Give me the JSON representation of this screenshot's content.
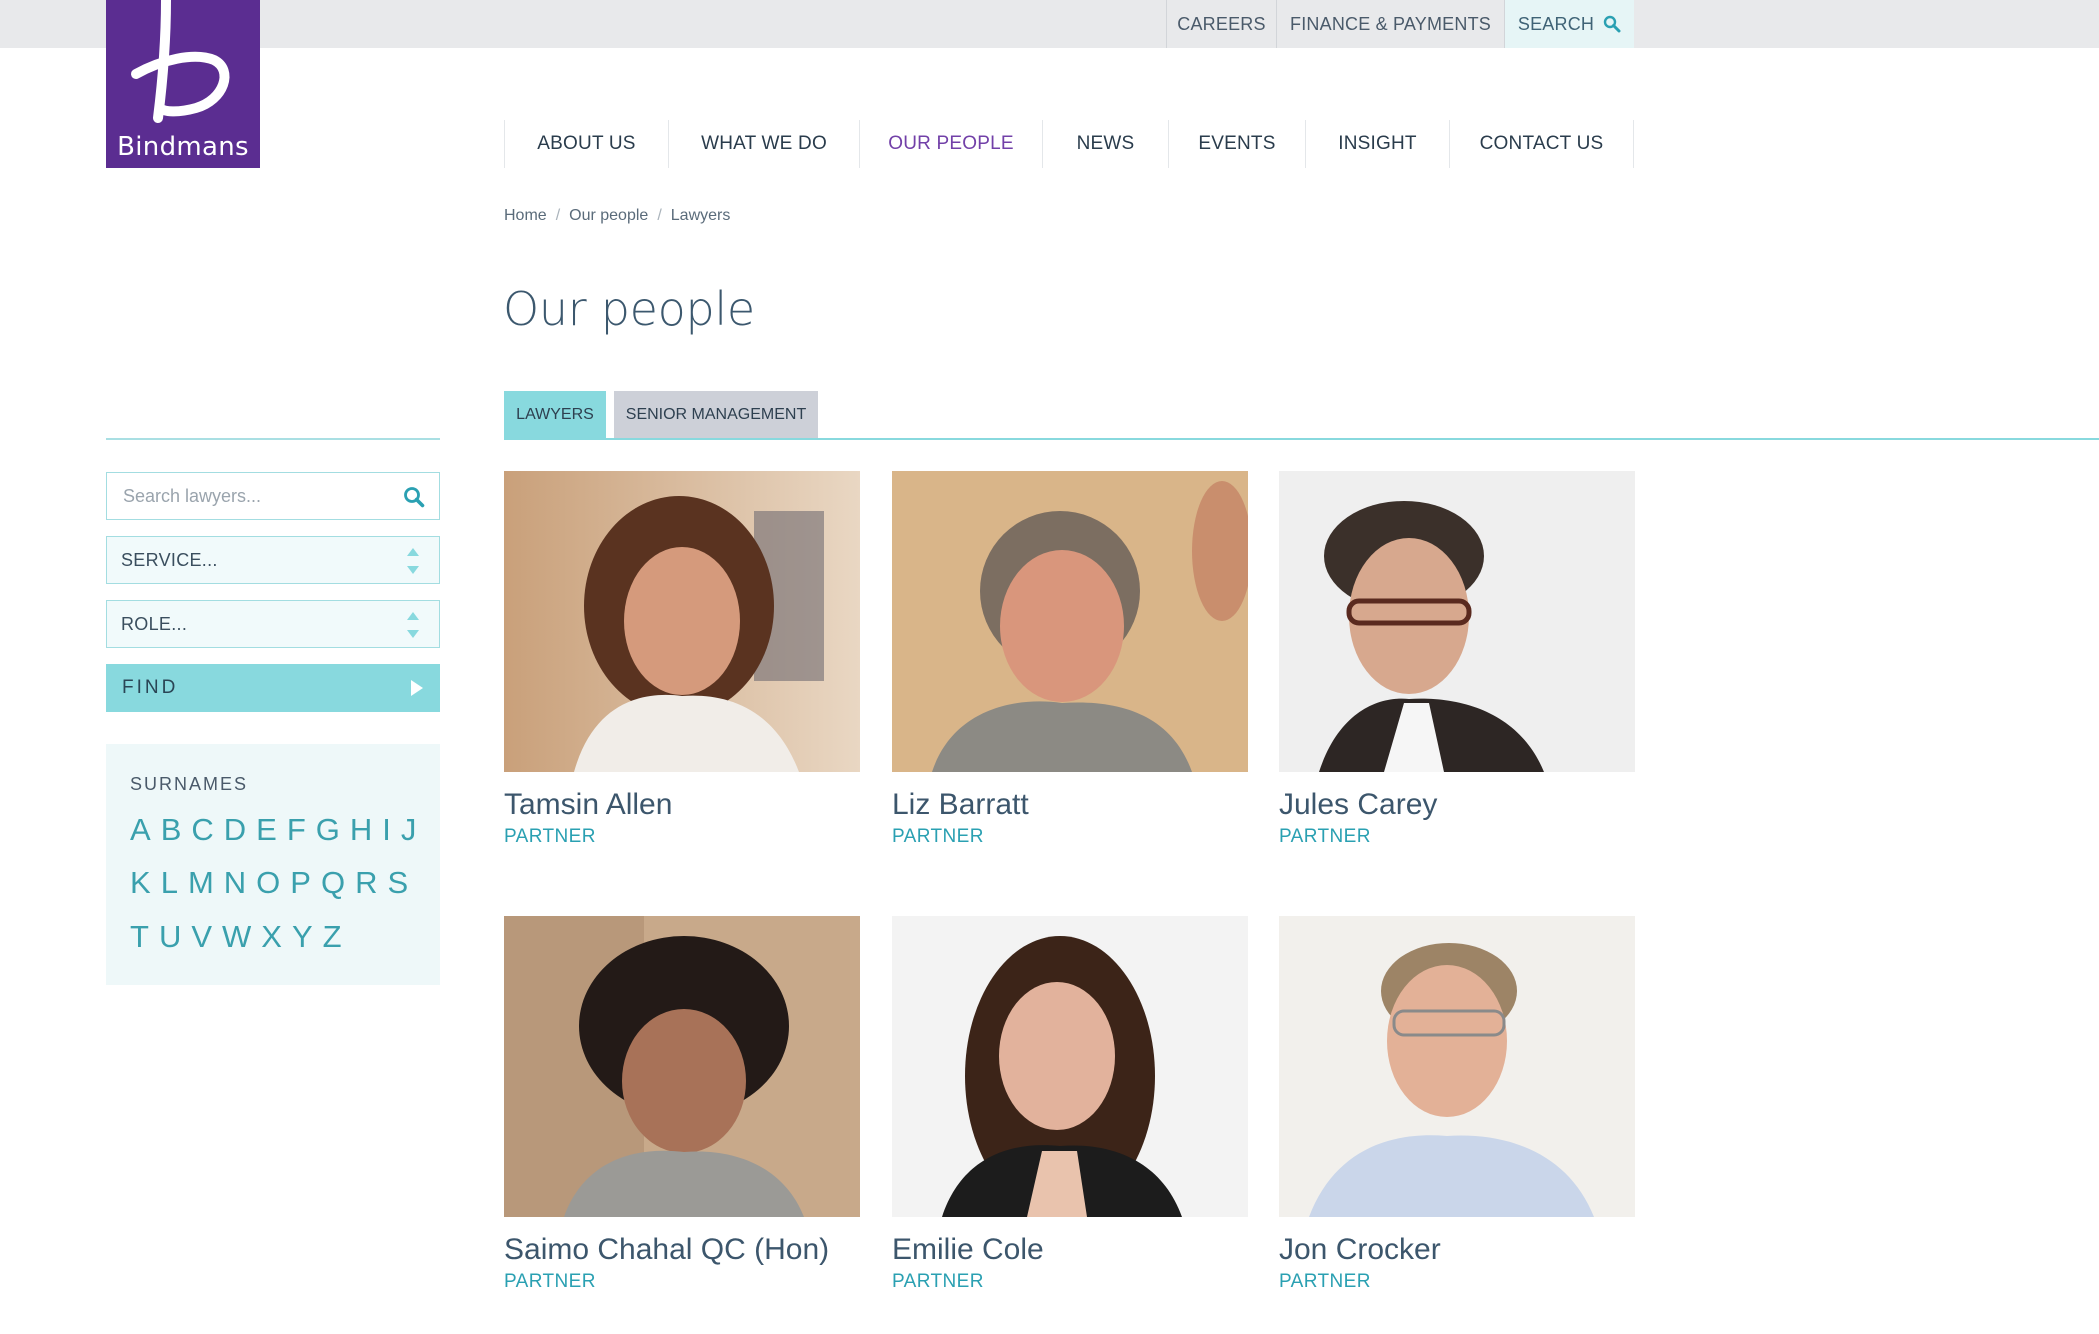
{
  "utility_nav": [
    {
      "label": "CAREERS"
    },
    {
      "label": "FINANCE & PAYMENTS"
    },
    {
      "label": "SEARCH"
    }
  ],
  "logo": {
    "text": "Bindmans"
  },
  "main_nav": [
    {
      "label": "ABOUT US"
    },
    {
      "label": "WHAT WE DO"
    },
    {
      "label": "OUR PEOPLE",
      "active": true
    },
    {
      "label": "NEWS"
    },
    {
      "label": "EVENTS"
    },
    {
      "label": "INSIGHT"
    },
    {
      "label": "CONTACT US"
    }
  ],
  "breadcrumb": [
    "Home",
    "Our people",
    "Lawyers"
  ],
  "page_title": "Our people",
  "tabs": [
    {
      "label": "LAWYERS",
      "active": true
    },
    {
      "label": "SENIOR MANAGEMENT",
      "active": false
    }
  ],
  "filters": {
    "search_placeholder": "Search lawyers...",
    "service_label": "SERVICE...",
    "role_label": "ROLE...",
    "find_label": "FIND"
  },
  "surnames": {
    "heading": "SURNAMES",
    "rows": [
      [
        "A",
        "B",
        "C",
        "D",
        "E",
        "F",
        "G",
        "H",
        "I",
        "J"
      ],
      [
        "K",
        "L",
        "M",
        "N",
        "O",
        "P",
        "Q",
        "R",
        "S"
      ],
      [
        "T",
        "U",
        "V",
        "W",
        "X",
        "Y",
        "Z"
      ]
    ]
  },
  "people": [
    {
      "name": "Tamsin Allen",
      "role": "PARTNER"
    },
    {
      "name": "Liz Barratt",
      "role": "PARTNER"
    },
    {
      "name": "Jules Carey",
      "role": "PARTNER"
    },
    {
      "name": "Saimo Chahal QC (Hon)",
      "role": "PARTNER"
    },
    {
      "name": "Emilie Cole",
      "role": "PARTNER"
    },
    {
      "name": "Jon Crocker",
      "role": "PARTNER"
    }
  ],
  "colors": {
    "brand_purple": "#5b2d91",
    "accent_teal": "#88d9de",
    "role_teal": "#2aa0b2",
    "active_nav": "#7240a8"
  }
}
